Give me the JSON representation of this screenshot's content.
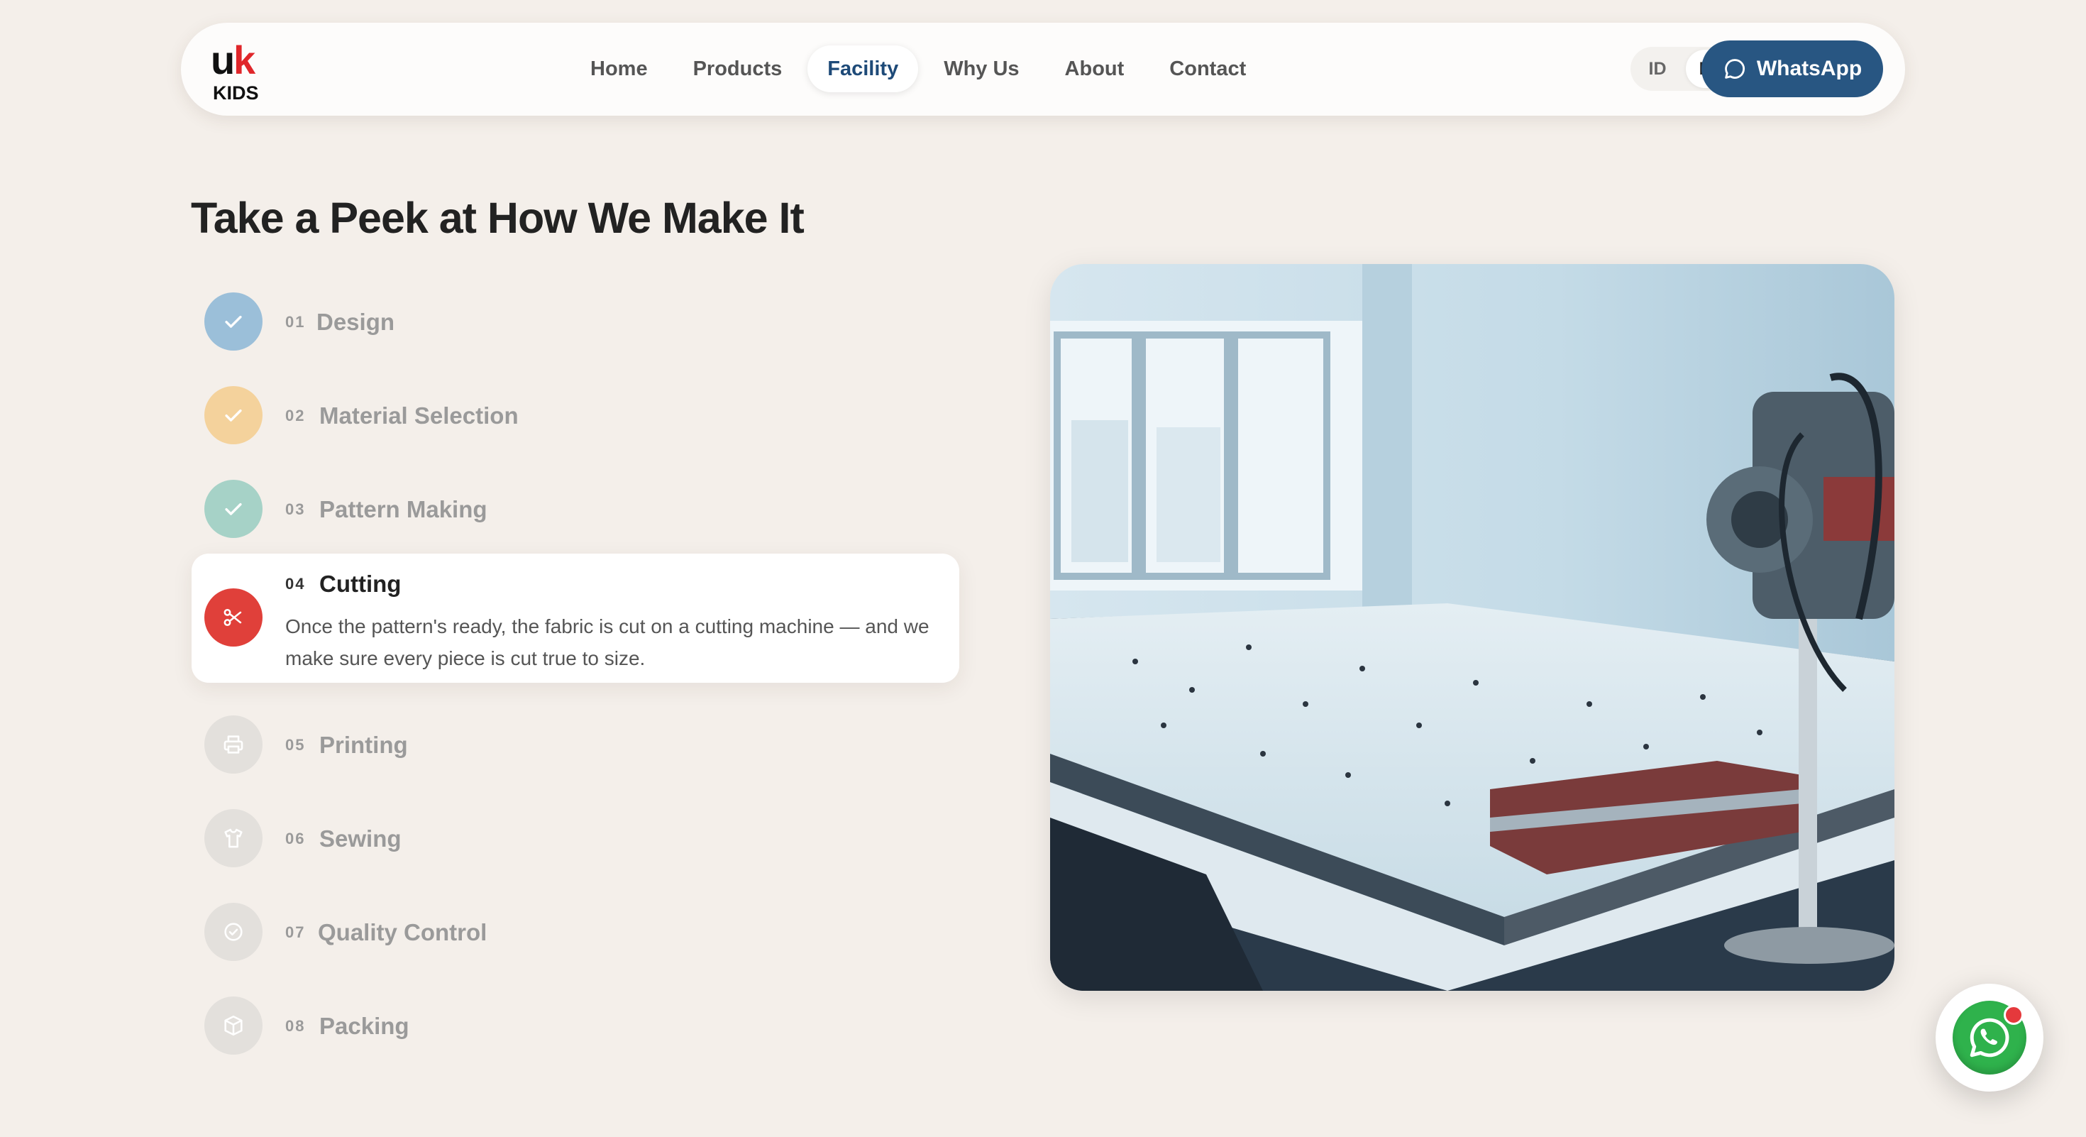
{
  "brand": {
    "logo_text_top": "uk",
    "logo_text_bottom": "KIDS"
  },
  "nav": {
    "items": [
      {
        "label": "Home",
        "active": false
      },
      {
        "label": "Products",
        "active": false
      },
      {
        "label": "Facility",
        "active": true
      },
      {
        "label": "Why Us",
        "active": false
      },
      {
        "label": "About",
        "active": false
      },
      {
        "label": "Contact",
        "active": false
      }
    ],
    "lang": {
      "id_label": "ID",
      "en_label": "EN",
      "selected": "EN"
    },
    "whatsapp_label": "WhatsApp"
  },
  "section": {
    "title": "Take a Peek at How We Make It",
    "steps": [
      {
        "num": "01",
        "title": "Design",
        "state": "done",
        "icon": "check-icon",
        "color": "#9bbfd9"
      },
      {
        "num": "02",
        "title": "Material Selection",
        "state": "done",
        "icon": "check-icon",
        "color": "#f4d29c"
      },
      {
        "num": "03",
        "title": "Pattern Making",
        "state": "done",
        "icon": "check-icon",
        "color": "#a6d2c7"
      },
      {
        "num": "04",
        "title": "Cutting",
        "state": "active",
        "icon": "scissors-icon",
        "color": "#e0403a",
        "description": "Once the pattern's ready, the fabric is cut on a cutting machine — and we make sure every piece is cut true to size."
      },
      {
        "num": "05",
        "title": "Printing",
        "state": "pending",
        "icon": "printer-icon",
        "color": "#e3e0dc"
      },
      {
        "num": "06",
        "title": "Sewing",
        "state": "pending",
        "icon": "shirt-icon",
        "color": "#e3e0dc"
      },
      {
        "num": "07",
        "title": "Quality Control",
        "state": "pending",
        "icon": "badge-check-icon",
        "color": "#e3e0dc"
      },
      {
        "num": "08",
        "title": "Packing",
        "state": "pending",
        "icon": "box-icon",
        "color": "#e3e0dc"
      }
    ]
  },
  "colors": {
    "background": "#f4efea",
    "accent": "#285682",
    "active_step": "#e0403a",
    "whatsapp_green": "#2fb24c"
  }
}
